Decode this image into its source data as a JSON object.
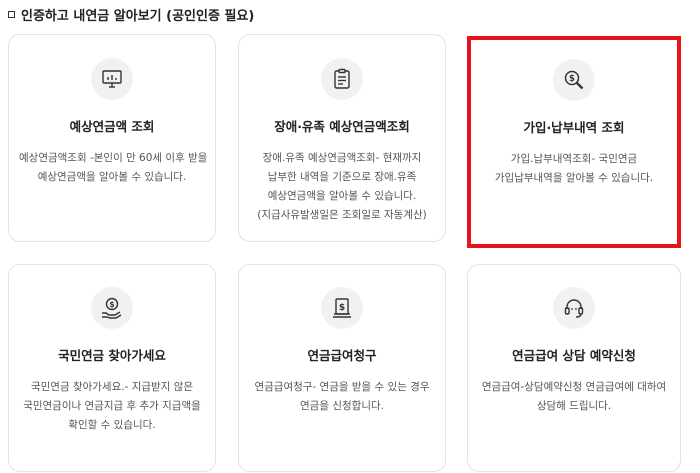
{
  "section": {
    "title": "인증하고 내연금 알아보기 (공인인증 필요)"
  },
  "cards": [
    {
      "icon": "monitor-chart-icon",
      "title": "예상연금액 조회",
      "lines": [
        "예상연금액조회 -본인이 만 60세 이후 받을",
        "예상연금액을 알아볼 수 있습니다."
      ]
    },
    {
      "icon": "clipboard-list-icon",
      "title": "장애·유족 예상연금액조회",
      "lines": [
        "장애.유족 예상연금액조회- 현재까지",
        "납부한 내역을 기준으로 장애.유족",
        "예상연금액을 알아볼 수 있습니다.",
        "(지급사유발생일은 조회일로 자동계산)"
      ]
    },
    {
      "icon": "magnifier-money-icon",
      "title": "가입·납부내역 조회",
      "lines": [
        "가입.납부내역조회- 국민연금",
        "가입납부내역을 알아볼 수 있습니다."
      ]
    },
    {
      "icon": "hand-coin-icon",
      "title": "국민연금 찾아가세요",
      "lines": [
        "국민연금 찾아가세요.- 지급받지 않은",
        "국민연금이나 연금지급 후 추가 지급액을",
        "확인할 수 있습니다."
      ]
    },
    {
      "icon": "money-document-icon",
      "title": "연금급여청구",
      "lines": [
        "연금급여청구- 연금을 받을 수 있는 경우",
        "연금을 신청합니다."
      ]
    },
    {
      "icon": "headset-icon",
      "title": "연금급여 상담 예약신청",
      "lines": [
        "연금급여-상담예약신청 연금급여에 대하여",
        "상담해 드립니다."
      ]
    }
  ],
  "colors": {
    "highlight": "#e8141b",
    "border": "#e3e3e3",
    "icon_bg": "#f1f1f1"
  }
}
